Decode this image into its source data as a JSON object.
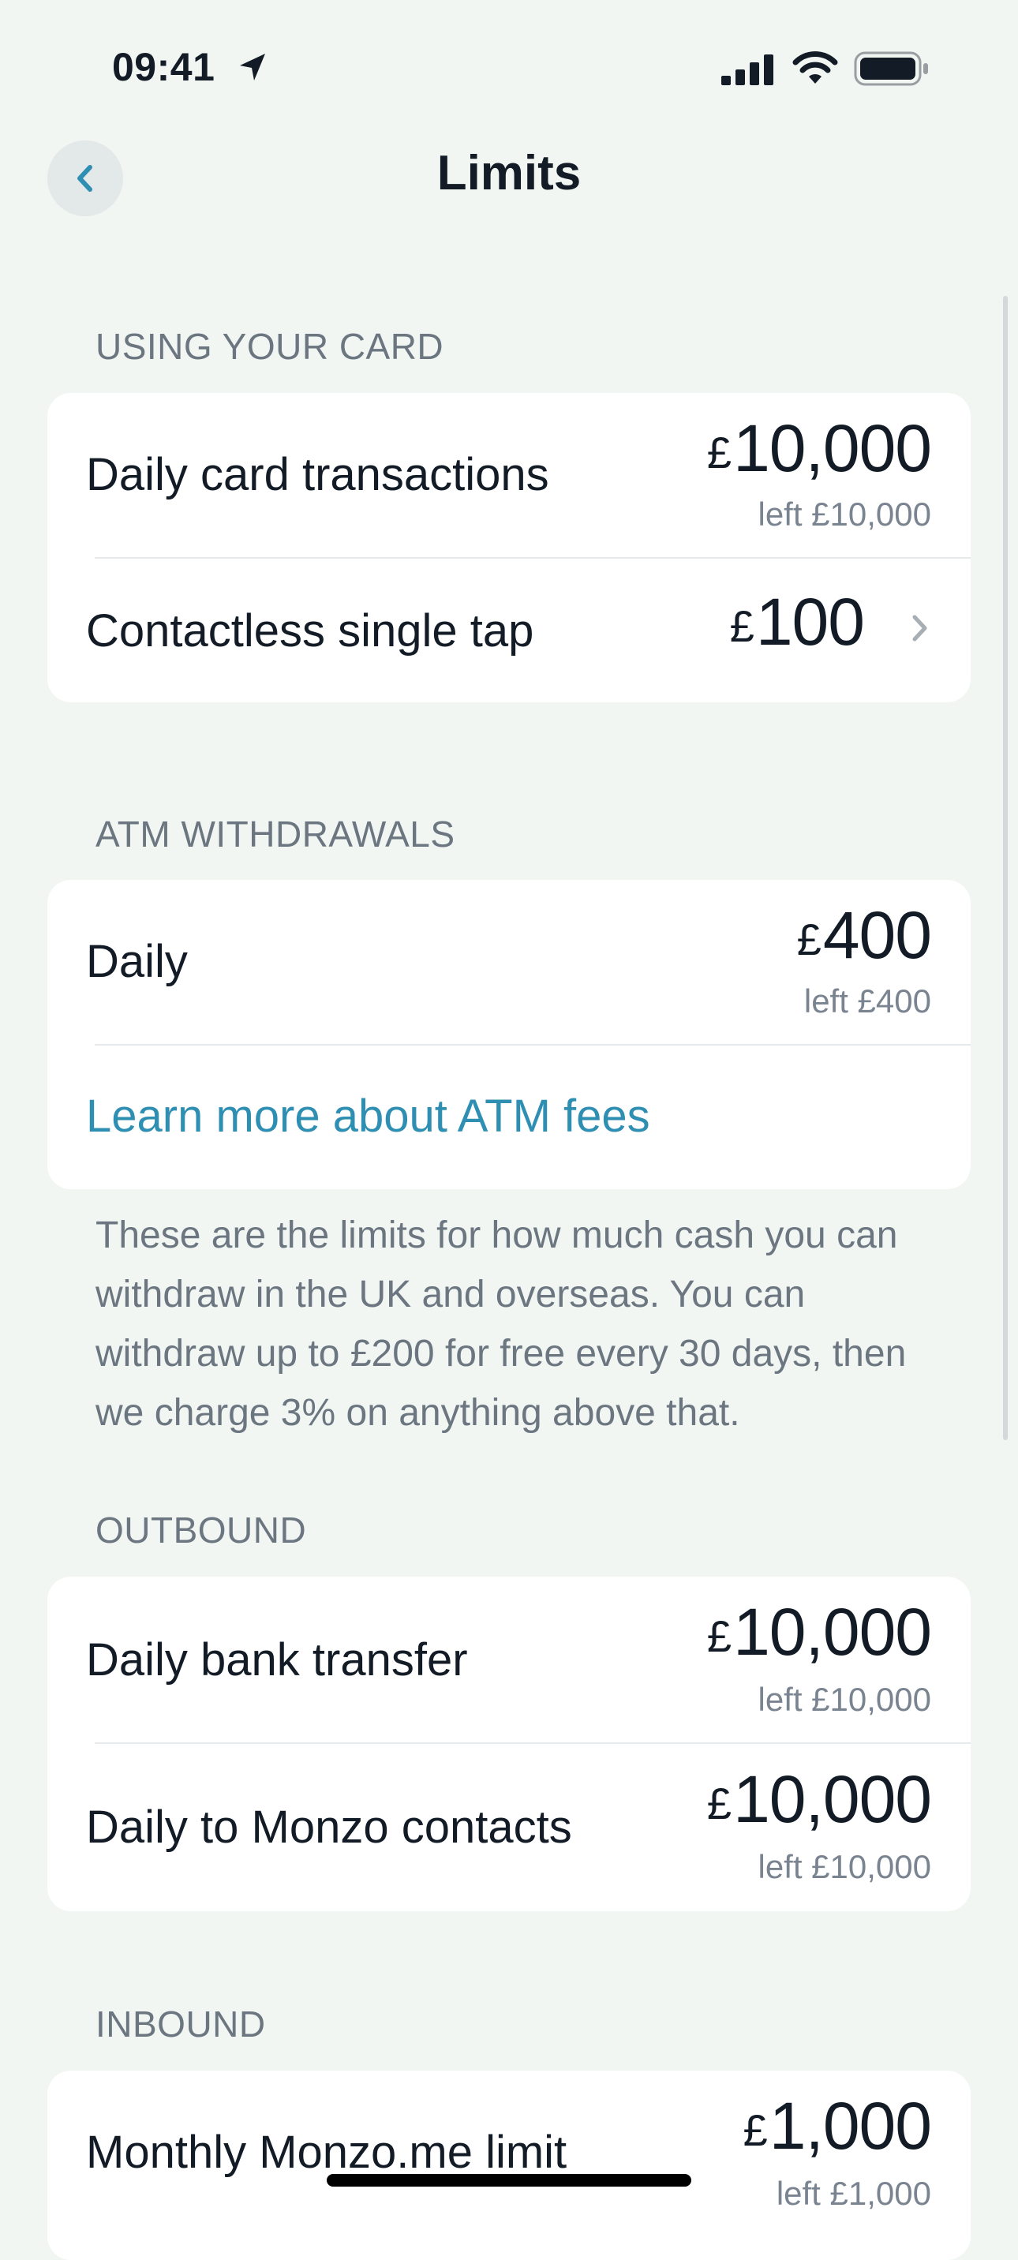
{
  "status_bar": {
    "time": "09:41",
    "location_icon": "location-arrow-icon",
    "signal_icon": "cellular-signal-icon",
    "wifi_icon": "wifi-icon",
    "battery_icon": "battery-icon"
  },
  "nav": {
    "title": "Limits",
    "back_icon": "chevron-left-icon"
  },
  "sections": {
    "card": {
      "header": "USING YOUR CARD",
      "rows": [
        {
          "label": "Daily card transactions",
          "currency": "£",
          "amount": "10,000",
          "left": "left £10,000"
        },
        {
          "label": "Contactless single tap",
          "currency": "£",
          "amount": "100",
          "chevron_icon": "chevron-right-icon"
        }
      ]
    },
    "atm": {
      "header": "ATM WITHDRAWALS",
      "rows": [
        {
          "label": "Daily",
          "currency": "£",
          "amount": "400",
          "left": "left £400"
        }
      ],
      "link": "Learn more about ATM fees",
      "explanation": "These are the limits for how much cash you can withdraw in the UK and overseas. You can withdraw up to £200 for free every 30 days, then we charge 3% on anything above that."
    },
    "outbound": {
      "header": "OUTBOUND",
      "rows": [
        {
          "label": "Daily bank transfer",
          "currency": "£",
          "amount": "10,000",
          "left": "left £10,000"
        },
        {
          "label": "Daily to Monzo contacts",
          "currency": "£",
          "amount": "10,000",
          "left": "left £10,000"
        }
      ]
    },
    "inbound": {
      "header": "INBOUND",
      "rows": [
        {
          "label": "Monthly Monzo.me limit",
          "currency": "£",
          "amount": "1,000",
          "left": "left £1,000"
        }
      ]
    }
  },
  "colors": {
    "background": "#f1f6f3",
    "card": "#ffffff",
    "text_primary": "#131c26",
    "text_secondary": "#6c7680",
    "link": "#2f8fb3"
  }
}
